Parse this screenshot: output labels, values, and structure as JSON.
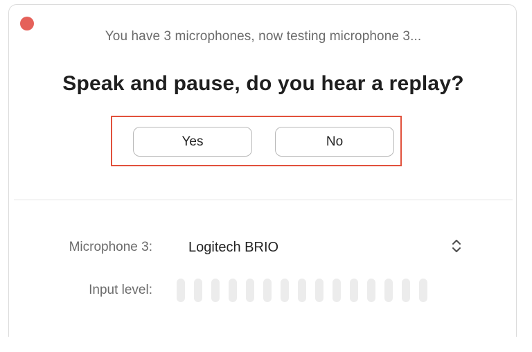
{
  "window": {
    "close_button_color": "#e5615a"
  },
  "header": {
    "subtitle": "You have 3 microphones, now testing microphone 3...",
    "question": "Speak and pause, do you hear a replay?"
  },
  "actions": {
    "yes_label": "Yes",
    "no_label": "No",
    "highlight_color": "#e1513c"
  },
  "settings": {
    "microphone_label": "Microphone 3:",
    "microphone_value": "Logitech BRIO",
    "microphone_selector_icon": "up-down-chevron-icon",
    "input_level_label": "Input level:",
    "input_level_segments": 15,
    "input_level_active_segments": 0
  }
}
